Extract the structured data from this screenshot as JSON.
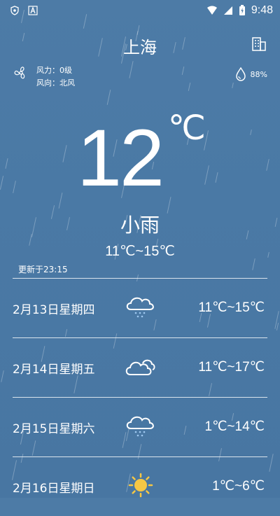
{
  "status_bar": {
    "time": "9:48"
  },
  "header": {
    "city": "上海"
  },
  "wind": {
    "force": "风力：0级",
    "direction": "风向：北风"
  },
  "humidity": "88%",
  "current": {
    "temperature": "12",
    "unit": "℃",
    "condition": "小雨",
    "range": "11℃~15℃",
    "updated": "更新于23:15"
  },
  "forecast": [
    {
      "date": "2月13日星期四",
      "icon": "rain-cloud-icon",
      "range": "11℃~15℃"
    },
    {
      "date": "2月14日星期五",
      "icon": "cloud-icon",
      "range": "11℃~17℃"
    },
    {
      "date": "2月15日星期六",
      "icon": "rain-cloud-icon",
      "range": "1℃~14℃"
    },
    {
      "date": "2月16日星期日",
      "icon": "sun-icon",
      "range": "1℃~6℃"
    }
  ],
  "colors": {
    "background": "#4a79a5",
    "accent_sun": "#f6c744",
    "rain_drop": "#9ec8f0"
  }
}
